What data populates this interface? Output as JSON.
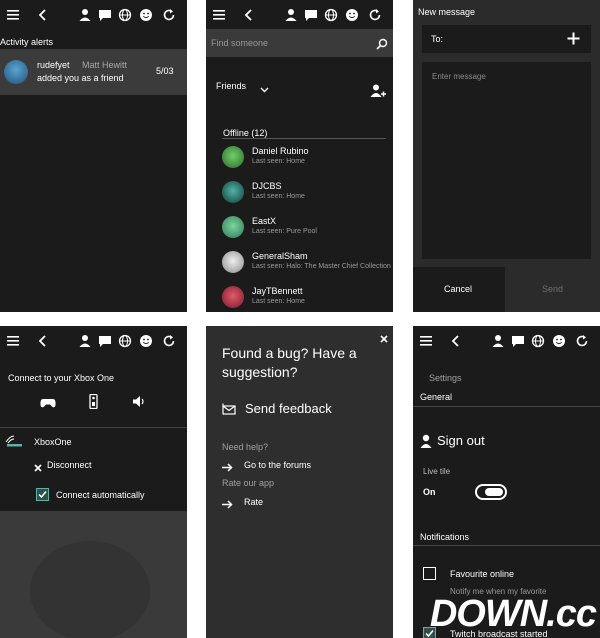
{
  "panel1": {
    "section_title": "Activity alerts",
    "notification": {
      "user": "rudefyet",
      "friend_name": "Matt Hewitt",
      "message": "added you as a friend",
      "date": "5/03"
    }
  },
  "panel2": {
    "search_placeholder": "Find someone",
    "friends_label": "Friends",
    "offline_label": "Offline (12)",
    "friends": [
      {
        "name": "Daniel Rubino",
        "last_seen": "Last seen: Home"
      },
      {
        "name": "DJCBS",
        "last_seen": "Last seen: Home"
      },
      {
        "name": "EastX",
        "last_seen": "Last seen: Pure Pool"
      },
      {
        "name": "GeneralSham",
        "last_seen": "Last seen: Halo: The Master Chief Collection"
      },
      {
        "name": "JayTBennett",
        "last_seen": "Last seen: Home"
      }
    ]
  },
  "panel3": {
    "title": "New message",
    "to_label": "To:",
    "message_placeholder": "Enter message",
    "cancel_label": "Cancel",
    "send_label": "Send"
  },
  "panel4": {
    "connect_title": "Connect to your Xbox One",
    "console_name": "XboxOne",
    "disconnect_label": "Disconnect",
    "auto_connect_label": "Connect automatically"
  },
  "panel5": {
    "headline": "Found a bug? Have a suggestion?",
    "send_feedback": "Send feedback",
    "need_help": "Need help?",
    "go_forums": "Go to the forums",
    "rate_app": "Rate our app",
    "rate": "Rate"
  },
  "panel6": {
    "settings_label": "Settings",
    "general_label": "General",
    "sign_out": "Sign out",
    "live_tile": "Live tile",
    "live_tile_state": "On",
    "notifications": "Notifications",
    "favourite_online": "Favourite online",
    "notify_sub": "Notify me when my favorite",
    "twitch": "Twitch broadcast started"
  },
  "watermark": "DOWN.cc",
  "colors": {
    "accent": "#5fb1a8",
    "dark_bg": "#1b1b1b",
    "panel_gray": "#2b2b2b"
  }
}
